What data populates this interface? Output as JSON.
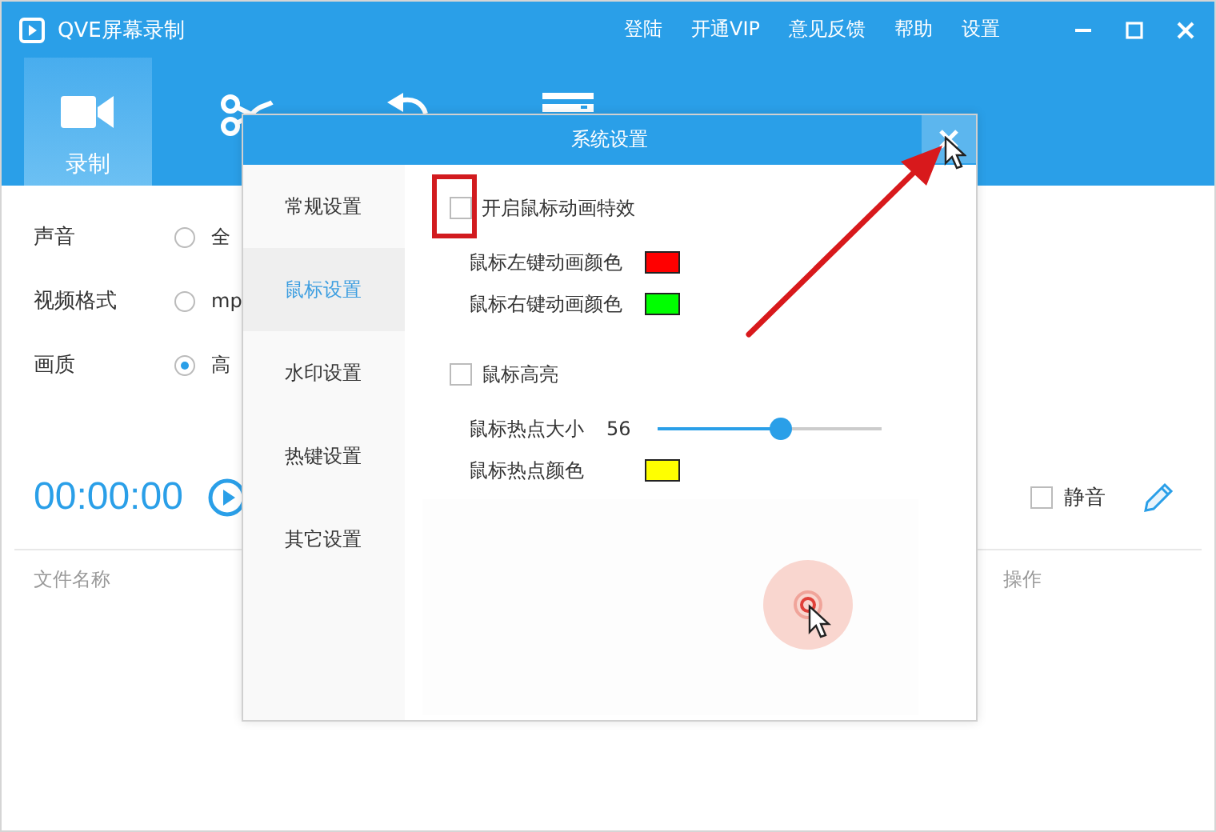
{
  "window": {
    "title": "QVE屏幕录制",
    "menu": [
      "登陆",
      "开通VIP",
      "意见反馈",
      "帮助",
      "设置"
    ]
  },
  "toolbar_tabs": [
    {
      "kind": "camera",
      "label": "录制",
      "selected": true
    },
    {
      "kind": "scissors",
      "selected": false
    },
    {
      "kind": "undo",
      "selected": false
    },
    {
      "kind": "toolbox",
      "selected": false
    }
  ],
  "settings": [
    {
      "label": "声音",
      "option": "全",
      "selected": false
    },
    {
      "label": "视频格式",
      "option": "mp",
      "selected": false
    },
    {
      "label": "画质",
      "option": "高",
      "selected": true
    }
  ],
  "timer": "00:00:00",
  "mute": {
    "label": "静音",
    "checked": false
  },
  "table": {
    "columns": [
      "文件名称",
      "操作"
    ]
  },
  "dialog": {
    "title": "系统设置",
    "nav": [
      {
        "label": "常规设置",
        "selected": false
      },
      {
        "label": "鼠标设置",
        "selected": true
      },
      {
        "label": "水印设置",
        "selected": false
      },
      {
        "label": "热键设置",
        "selected": false
      },
      {
        "label": "其它设置",
        "selected": false
      }
    ],
    "options": [
      {
        "kind": "checkbox",
        "label": "开启鼠标动画特效",
        "checked": false,
        "highlighted": true
      },
      {
        "kind": "color",
        "label": "鼠标左键动画颜色",
        "color": "#ff0000"
      },
      {
        "kind": "color",
        "label": "鼠标右键动画颜色",
        "color": "#00ff00"
      },
      {
        "kind": "checkbox",
        "label": "鼠标高亮",
        "checked": false,
        "highlighted": false
      },
      {
        "kind": "slider",
        "label": "鼠标热点大小",
        "reading": "56",
        "level": 0.55
      },
      {
        "kind": "color",
        "label": "鼠标热点颜色",
        "color": "#ffff00"
      }
    ]
  }
}
